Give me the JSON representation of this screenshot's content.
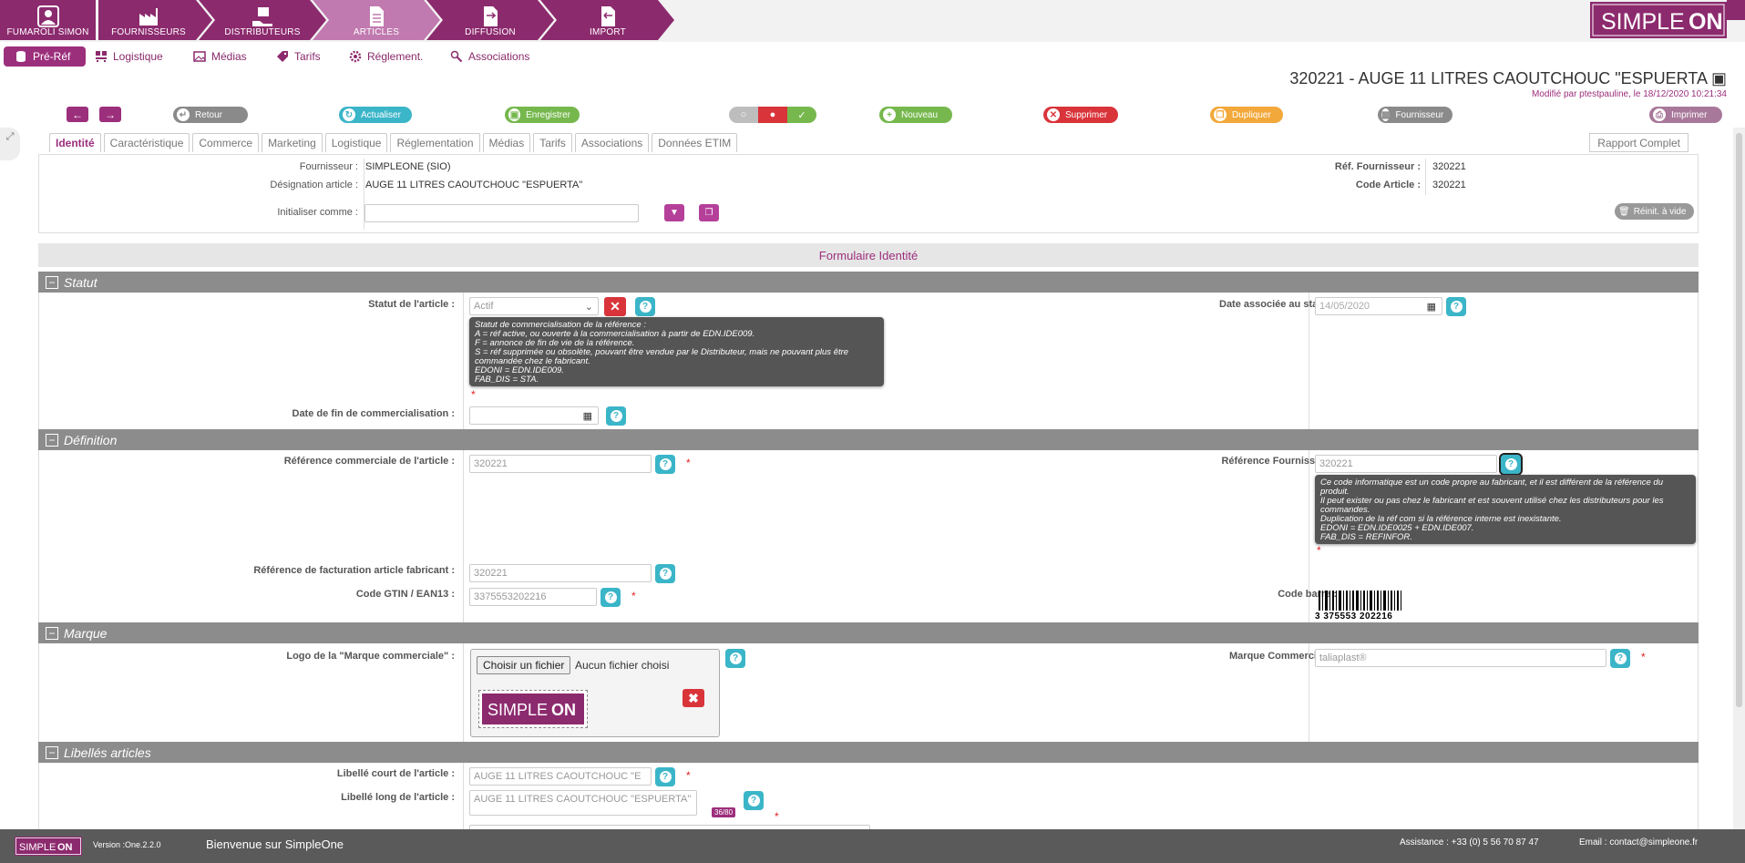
{
  "nav": {
    "tabs": [
      {
        "label": "FUMAROLI SIMON",
        "icon": "user-icon"
      },
      {
        "label": "FOURNISSEURS",
        "icon": "factory-icon"
      },
      {
        "label": "DISTRIBUTEURS",
        "icon": "distributor-icon"
      },
      {
        "label": "ARTICLES",
        "icon": "document-icon"
      },
      {
        "label": "DIFFUSION",
        "icon": "diffusion-icon"
      },
      {
        "label": "IMPORT",
        "icon": "import-icon"
      }
    ],
    "brand": "SIMPLEONE",
    "colors": {
      "nav_dark": "#8c2a6e",
      "nav_active": "#c07aaf",
      "accent": "#9c2f7c"
    }
  },
  "subnav": {
    "items": [
      "Pré-Réf",
      "Logistique",
      "Médias",
      "Tarifs",
      "Réglement.",
      "Associations"
    ]
  },
  "header": {
    "title": "320221 - AUGE 11 LITRES CAOUTCHOUC \"ESPUERTA",
    "modified": "Modifié par ptestpauline, le 18/12/2020 10:21:34"
  },
  "toolbar": {
    "back": "Retour",
    "refresh": "Actualiser",
    "save": "Enregistrer",
    "new": "Nouveau",
    "delete": "Supprimer",
    "duplicate": "Dupliquer",
    "supplier": "Fournisseur",
    "print": "Imprimer"
  },
  "tabs": [
    "Identité",
    "Caractéristique",
    "Commerce",
    "Marketing",
    "Logistique",
    "Réglementation",
    "Médias",
    "Tarifs",
    "Associations",
    "Données ETIM"
  ],
  "report_tab": "Rapport Complet",
  "info": {
    "supplier_label": "Fournisseur :",
    "supplier_value": "SIMPLEONE (SIO)",
    "designation_label": "Désignation article :",
    "designation_value": "AUGE 11 LITRES CAOUTCHOUC \"ESPUERTA\"",
    "init_label": "Initialiser comme :",
    "ref_supplier_label": "Réf. Fournisseur :",
    "ref_supplier_value": "320221",
    "code_article_label": "Code Article :",
    "code_article_value": "320221",
    "reinit": "Réinit. à vide"
  },
  "form_title": "Formulaire Identité",
  "statut": {
    "title": "Statut",
    "status_label": "Statut de l'article :",
    "status_value": "Actif",
    "date_label": "Date associée au statut :",
    "date_value": "14/05/2020",
    "tooltip": [
      "Statut de commercialisation de la référence :",
      "A = réf active, ou ouverte à la commercialisation à partir de EDN.IDE009.",
      "F = annonce de fin de vie de la référence.",
      "S = réf supprimée ou obsolète, pouvant être vendue par le Distributeur, mais ne pouvant plus être",
      "commandée chez le fabricant.",
      "EDONI = EDN.IDE009.",
      "FAB_DIS = STA."
    ],
    "end_label": "Date de fin de commercialisation :"
  },
  "definition": {
    "title": "Définition",
    "ref_com_label": "Référence commerciale de l'article :",
    "ref_com_value": "320221",
    "ref_four_label": "Référence Fournisseur :",
    "ref_four_value": "320221",
    "tooltip": [
      "Ce code informatique est un code propre au fabricant, et il est différent de la référence du",
      "produit.",
      "Il peut exister ou pas chez le fabricant et est souvent utilisé chez les distributeurs pour les",
      "commandes.",
      "Duplication de la réf com si la référence interne est inexistante.",
      "EDONI = EDN.IDE0025 + EDN.IDE007.",
      "FAB_DIS = REFINFOR."
    ],
    "ref_fact_label": "Référence de facturation article fabricant :",
    "ref_fact_value": "320221",
    "gtin_label": "Code GTIN / EAN13 :",
    "gtin_value": "3375553202216",
    "barcode_label": "Code barre :",
    "barcode_text": "3 375553 202216"
  },
  "marque": {
    "title": "Marque",
    "logo_label": "Logo de la \"Marque commerciale\" :",
    "file_button": "Choisir un fichier",
    "file_text": "Aucun fichier choisi",
    "logo_brand": "SIMPLEONE",
    "marque_label": "Marque Commerciale :",
    "marque_value": "taliaplast®"
  },
  "libelles": {
    "title": "Libellés articles",
    "court_label": "Libellé court de l'article :",
    "court_value": "AUGE 11 LITRES CAOUTCHOUC \"E",
    "long_label": "Libellé long de l'article :",
    "long_value": "AUGE 11 LITRES CAOUTCHOUC \"ESPUERTA\"",
    "long_count": "36/80"
  },
  "footer": {
    "brand": "SIMPLEONE",
    "version": "Version :One.2.2.0",
    "welcome": "Bienvenue sur SimpleOne",
    "assistance": "Assistance : +33 (0) 5 56 70 87 47",
    "email": "Email : contact@simpleone.fr"
  }
}
